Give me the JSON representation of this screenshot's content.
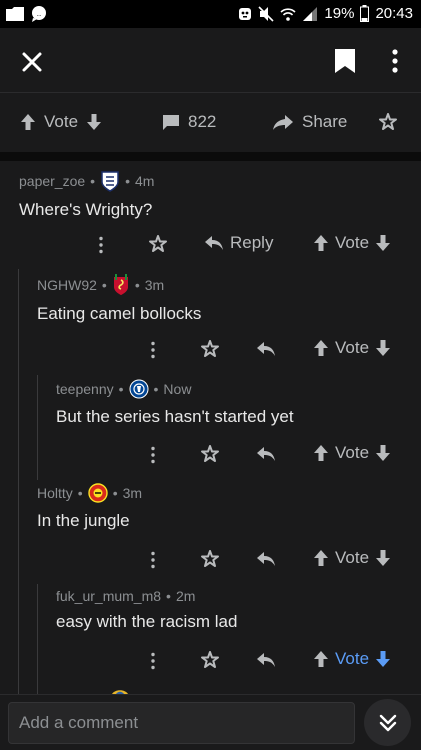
{
  "status_bar": {
    "battery": "19%",
    "time": "20:43"
  },
  "post_actions": {
    "vote_label": "Vote",
    "comment_count": "822",
    "share_label": "Share"
  },
  "comments": [
    {
      "author": "paper_zoe",
      "age": "4m",
      "body": "Where's Wrighty?",
      "reply_label": "Reply",
      "vote_label": "Vote",
      "flair": "england-badge"
    },
    {
      "author": "NGHW92",
      "age": "3m",
      "body": "Eating camel bollocks",
      "vote_label": "Vote",
      "flair": "liverpool-badge"
    },
    {
      "author": "teepenny",
      "age": "Now",
      "body": "But the series hasn't started yet",
      "vote_label": "Vote",
      "flair": "chelsea-badge"
    },
    {
      "author": "Holtty",
      "age": "3m",
      "body": "In the jungle",
      "vote_label": "Vote",
      "flair": "man-utd-badge"
    },
    {
      "author": "fuk_ur_mum_m8",
      "age": "2m",
      "body": "easy with the racism lad",
      "vote_label": "Vote",
      "vote_state": "downvoted"
    }
  ],
  "composer": {
    "placeholder": "Add a comment"
  },
  "colors": {
    "background": "#1a1a1b",
    "text": "#d7dadc",
    "muted": "#8c8f92",
    "accent_blue": "#5b9cf6"
  }
}
